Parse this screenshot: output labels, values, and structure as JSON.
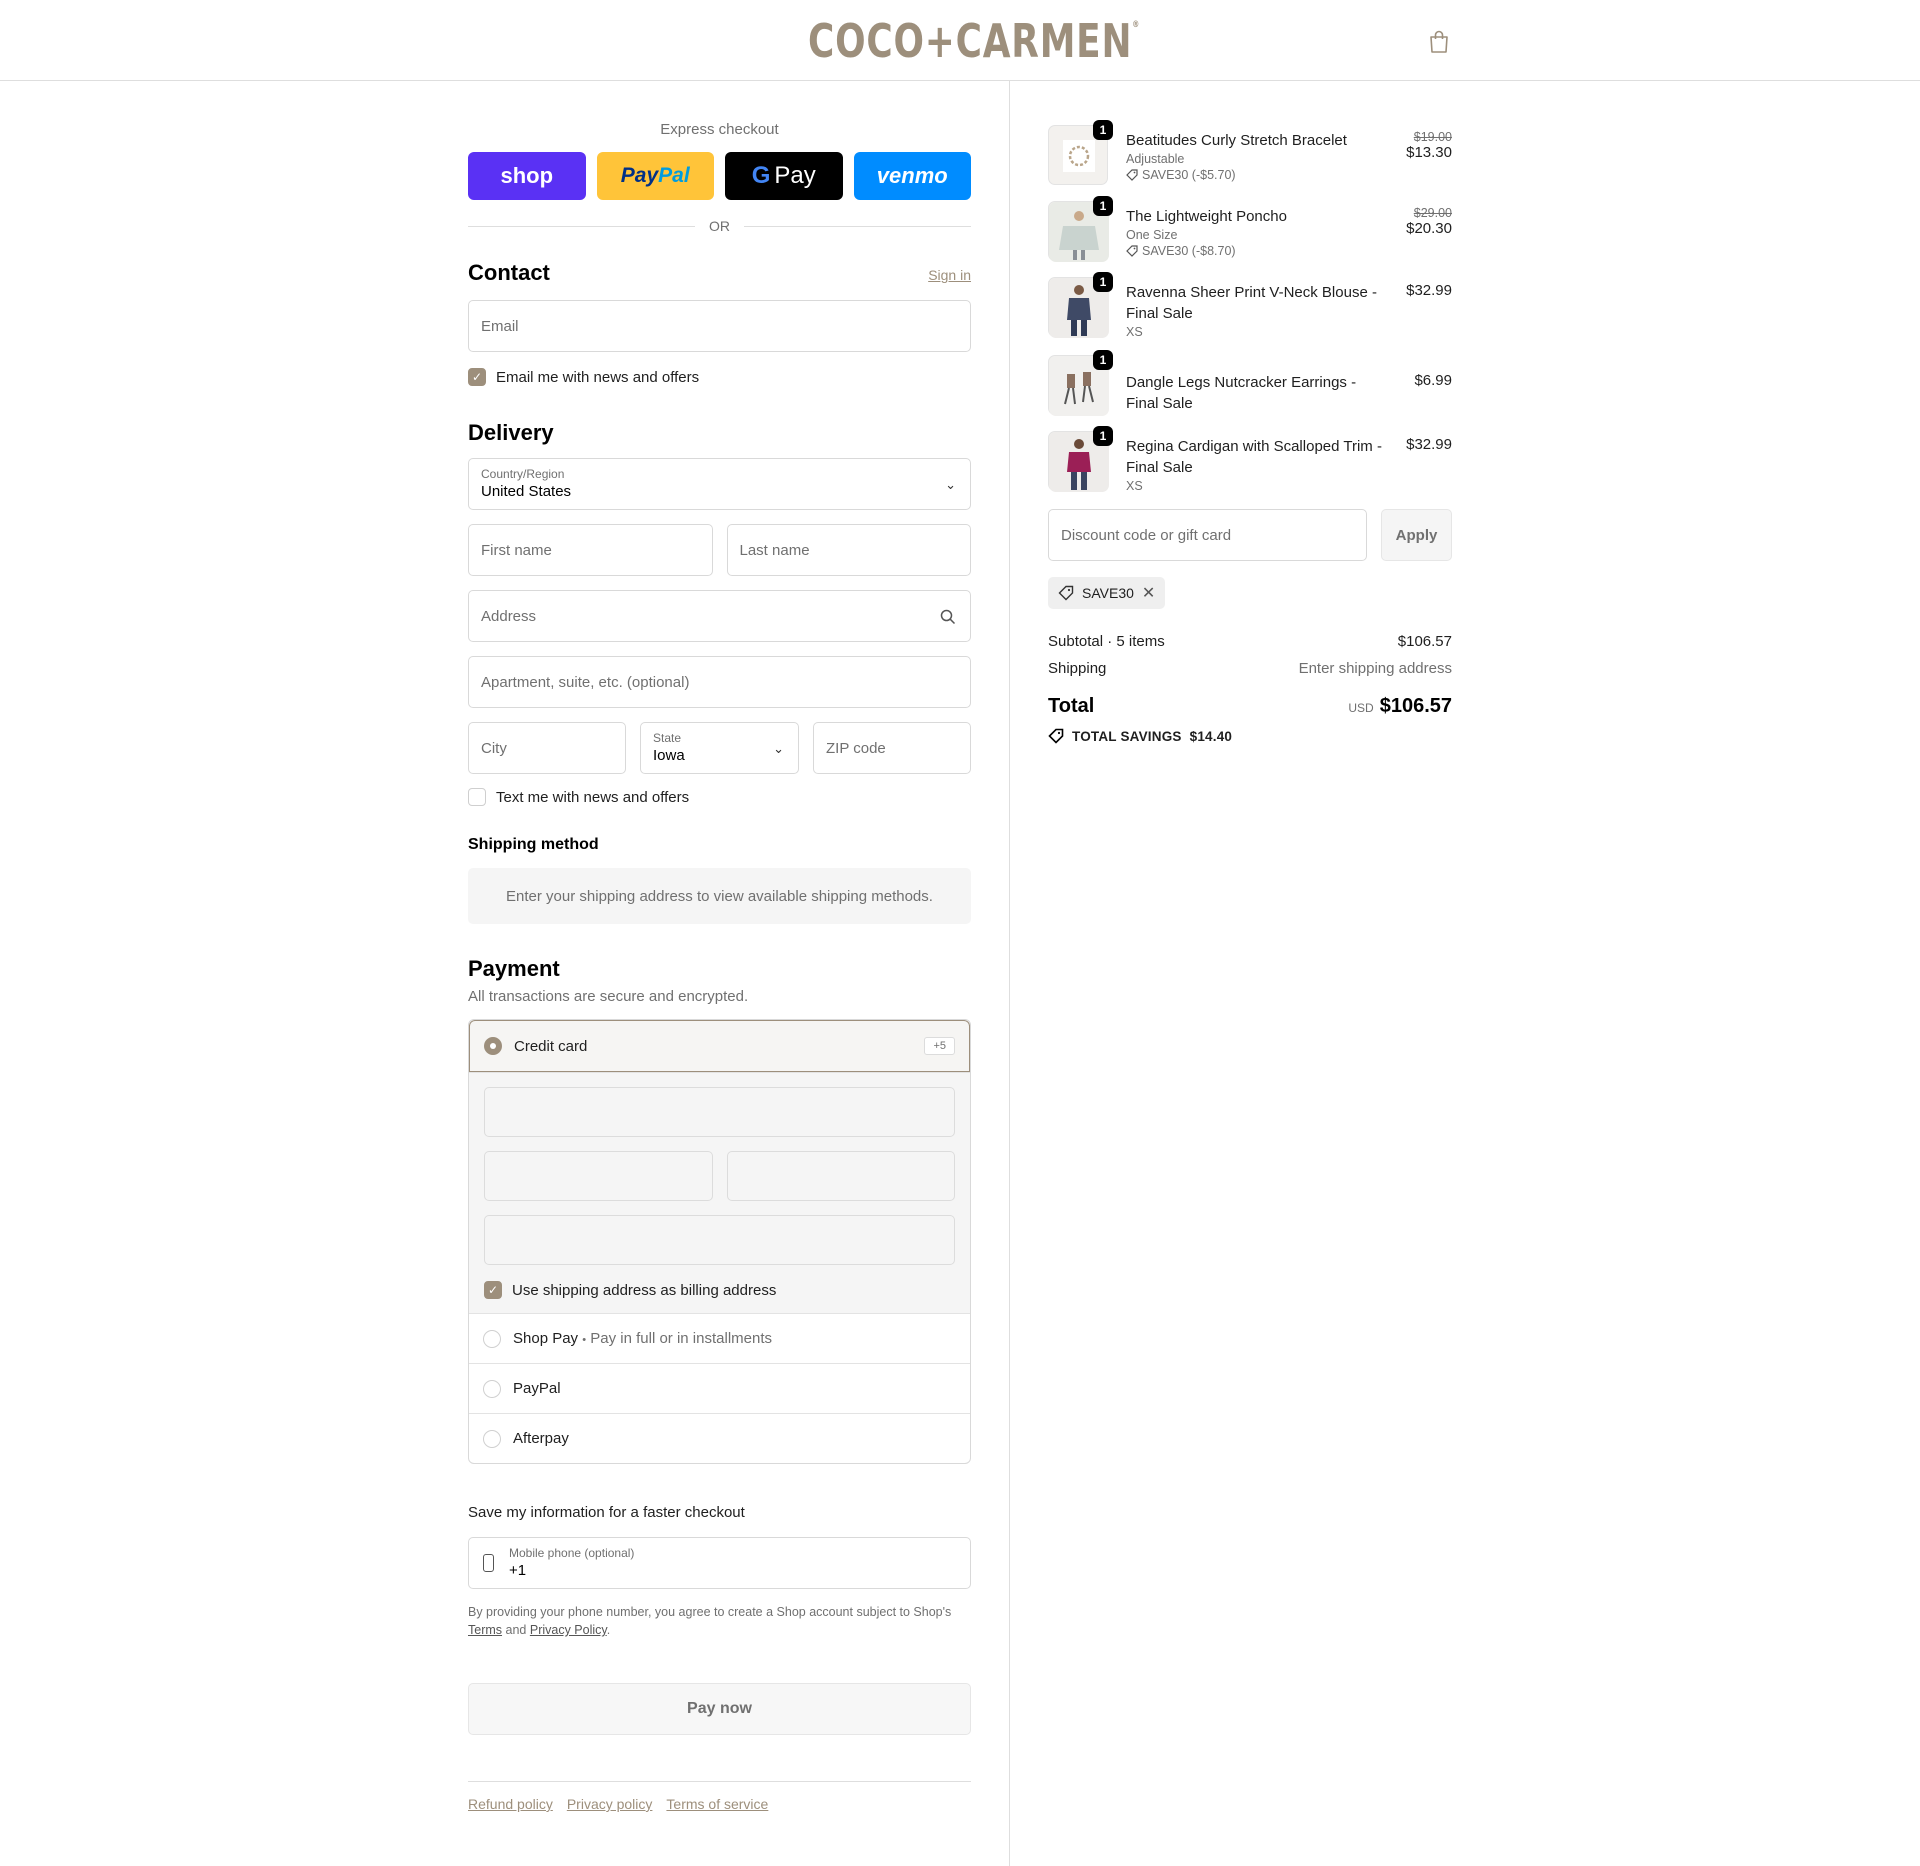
{
  "header": {
    "logo": "COCO+CARMEN",
    "logo_mark": "®",
    "cart_icon": "shopping-bag-icon"
  },
  "express": {
    "title": "Express checkout",
    "buttons": {
      "shop": "shop",
      "paypal_a": "Pay",
      "paypal_b": "Pal",
      "gpay_g": "G",
      "gpay": "Pay",
      "venmo": "venmo"
    },
    "or": "OR"
  },
  "contact": {
    "title": "Contact",
    "sign_in": "Sign in",
    "email_placeholder": "Email",
    "news_checkbox": "Email me with news and offers",
    "news_checked": true
  },
  "delivery": {
    "title": "Delivery",
    "country_label": "Country/Region",
    "country_value": "United States",
    "first_name": "First name",
    "last_name": "Last name",
    "address": "Address",
    "apartment": "Apartment, suite, etc. (optional)",
    "city": "City",
    "state_label": "State",
    "state_value": "Iowa",
    "zip": "ZIP code",
    "text_checkbox": "Text me with news and offers",
    "text_checked": false
  },
  "shipping_method": {
    "title": "Shipping method",
    "message": "Enter your shipping address to view available shipping methods."
  },
  "payment": {
    "title": "Payment",
    "subtitle": "All transactions are secure and encrypted.",
    "options": [
      {
        "label": "Credit card",
        "badge": "+5",
        "selected": true
      },
      {
        "label": "Shop Pay",
        "sub": "Pay in full or in installments",
        "selected": false
      },
      {
        "label": "PayPal",
        "selected": false
      },
      {
        "label": "Afterpay",
        "selected": false
      }
    ],
    "billing_checkbox": "Use shipping address as billing address",
    "billing_checked": true,
    "separator": "•"
  },
  "save_info": {
    "title": "Save my information for a faster checkout",
    "phone_label": "Mobile phone (optional)",
    "phone_value": "+1",
    "legal_pre": "By providing your phone number, you agree to create a Shop account subject to Shop's",
    "terms": "Terms",
    "and": "and",
    "privacy": "Privacy Policy",
    "period": "."
  },
  "pay_now": "Pay now",
  "footer": {
    "refund": "Refund policy",
    "privacy": "Privacy policy",
    "terms": "Terms of service"
  },
  "order": {
    "items": [
      {
        "qty": "1",
        "name": "Beatitudes Curly Stretch Bracelet",
        "variant": "Adjustable",
        "discount": "SAVE30 (-$5.70)",
        "orig_price": "$19.00",
        "price": "$13.30"
      },
      {
        "qty": "1",
        "name": "The Lightweight Poncho",
        "variant": "One Size",
        "discount": "SAVE30 (-$8.70)",
        "orig_price": "$29.00",
        "price": "$20.30"
      },
      {
        "qty": "1",
        "name": "Ravenna Sheer Print V-Neck Blouse - Final Sale",
        "variant": "XS",
        "price": "$32.99"
      },
      {
        "qty": "1",
        "name": "Dangle Legs Nutcracker Earrings - Final Sale",
        "price": "$6.99"
      },
      {
        "qty": "1",
        "name": "Regina Cardigan with Scalloped Trim - Final Sale",
        "variant": "XS",
        "price": "$32.99"
      }
    ],
    "discount_placeholder": "Discount code or gift card",
    "apply": "Apply",
    "applied_code": "SAVE30",
    "subtotal_label": "Subtotal · 5 items",
    "subtotal_value": "$106.57",
    "shipping_label": "Shipping",
    "shipping_value": "Enter shipping address",
    "total_label": "Total",
    "currency": "USD",
    "total_value": "$106.57",
    "savings_label": "TOTAL SAVINGS",
    "savings_value": "$14.40"
  },
  "colors": {
    "accent": "#9d8f7c",
    "shop": "#5a31f4",
    "paypal": "#ffc439",
    "venmo": "#008cff"
  }
}
